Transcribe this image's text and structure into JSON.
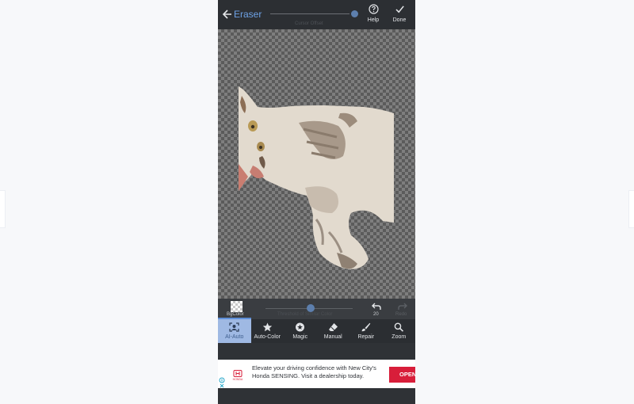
{
  "app": {
    "title": "Eraser",
    "caption_offset": "Cursor Offset",
    "help_label": "Help",
    "done_label": "Done"
  },
  "threshold_bar": {
    "bgcolor_label": "BgColor",
    "caption": "Threshold of Similar Color",
    "undo_count": "20",
    "redo_label": "Redo"
  },
  "tools": [
    {
      "label": "AI-Auto",
      "icon": "ai-auto-icon",
      "active": true
    },
    {
      "label": "Auto-Color",
      "icon": "star-icon",
      "active": false
    },
    {
      "label": "Magic",
      "icon": "magic-icon",
      "active": false
    },
    {
      "label": "Manual",
      "icon": "eraser-icon",
      "active": false
    },
    {
      "label": "Repair",
      "icon": "brush-icon",
      "active": false
    },
    {
      "label": "Zoom",
      "icon": "zoom-icon",
      "active": false
    }
  ],
  "ad": {
    "text": "Elevate your driving confidence with New City's Honda SENSING. Visit a dealership today.",
    "cta": "OPEN",
    "brand": "HONDA"
  },
  "colors": {
    "accent": "#6ea2e6",
    "active_tool": "#9fb9e3",
    "cta": "#d81e3a"
  }
}
